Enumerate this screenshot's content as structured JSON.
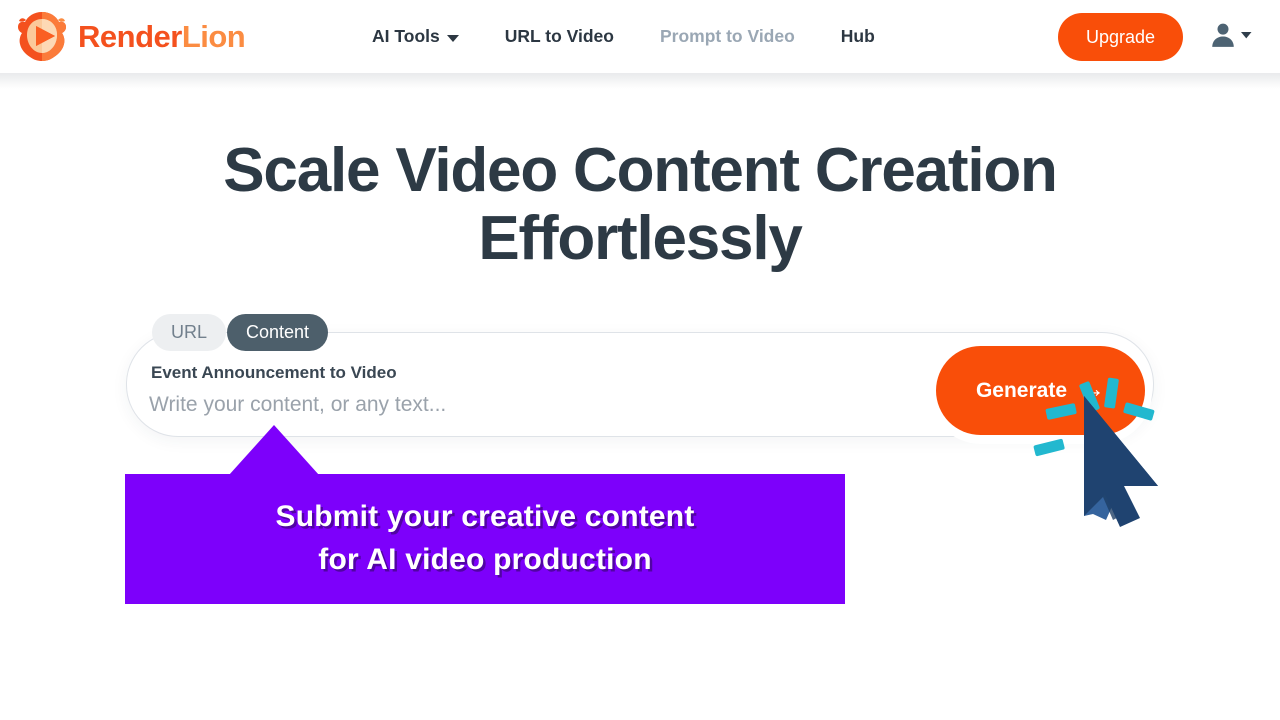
{
  "brand": {
    "name_part1": "Render",
    "name_part2": "Lion",
    "logo_icon": "lion-play-logo",
    "colors": {
      "primary": "#f4511e",
      "secondary": "#fb8c42"
    }
  },
  "header": {
    "nav": [
      {
        "label": "AI Tools",
        "has_dropdown": true,
        "state": "default",
        "icon": "chevron-down-icon"
      },
      {
        "label": "URL to Video",
        "has_dropdown": false,
        "state": "default"
      },
      {
        "label": "Prompt to Video",
        "has_dropdown": false,
        "state": "muted"
      },
      {
        "label": "Hub",
        "has_dropdown": false,
        "state": "default"
      }
    ],
    "upgrade_label": "Upgrade",
    "account_icon": "user-avatar-icon",
    "account_caret_icon": "chevron-down-icon",
    "upgrade_color": "#f94e09"
  },
  "hero": {
    "title_line1": "Scale Video Content Creation",
    "title_line2": "Effortlessly",
    "title_color": "#2d3a45"
  },
  "input_card": {
    "tabs": [
      {
        "label": "URL",
        "active": false
      },
      {
        "label": "Content",
        "active": true
      }
    ],
    "label": "Event Announcement to Video",
    "input_value": "",
    "input_placeholder": "Write your content, or any text...",
    "generate_label": "Generate",
    "generate_arrow": "→",
    "generate_color": "#f94e09",
    "active_tab_color": "#4d5f6b",
    "inactive_tab_color": "#edeff1"
  },
  "callout": {
    "line1": "Submit your creative content",
    "line2": "for AI video production",
    "background": "#7d00fb",
    "text_color": "#ffffff",
    "pointer": "up-triangle"
  },
  "cursor": {
    "icon": "mouse-pointer-click-icon",
    "burst_color": "#22b8cf",
    "pointer_light": "#35649e",
    "pointer_dark": "#1c3c63"
  }
}
